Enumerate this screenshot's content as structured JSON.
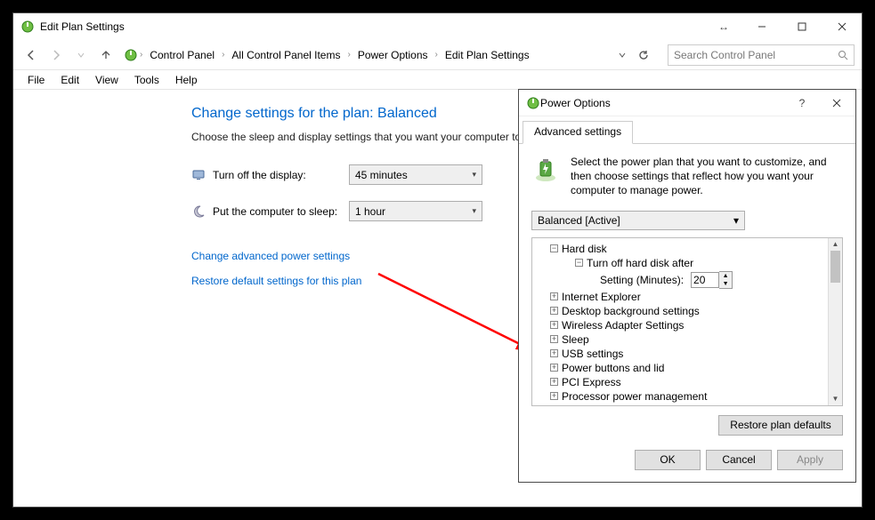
{
  "main": {
    "title": "Edit Plan Settings",
    "breadcrumbs": [
      "Control Panel",
      "All Control Panel Items",
      "Power Options",
      "Edit Plan Settings"
    ],
    "search_placeholder": "Search Control Panel",
    "menu": [
      "File",
      "Edit",
      "View",
      "Tools",
      "Help"
    ],
    "heading": "Change settings for the plan: Balanced",
    "subtext": "Choose the sleep and display settings that you want your computer to use.",
    "rows": {
      "display_label": "Turn off the display:",
      "display_value": "45 minutes",
      "sleep_label": "Put the computer to sleep:",
      "sleep_value": "1 hour"
    },
    "links": {
      "advanced": "Change advanced power settings",
      "restore": "Restore default settings for this plan"
    }
  },
  "dialog": {
    "title": "Power Options",
    "tab": "Advanced settings",
    "desc": "Select the power plan that you want to customize, and then choose settings that reflect how you want your computer to manage power.",
    "plan_combo": "Balanced [Active]",
    "tree": {
      "hard_disk": "Hard disk",
      "turn_off_after": "Turn off hard disk after",
      "setting_label": "Setting (Minutes):",
      "setting_value": "20",
      "items": [
        "Internet Explorer",
        "Desktop background settings",
        "Wireless Adapter Settings",
        "Sleep",
        "USB settings",
        "Power buttons and lid",
        "PCI Express",
        "Processor power management"
      ]
    },
    "restore_btn": "Restore plan defaults",
    "buttons": {
      "ok": "OK",
      "cancel": "Cancel",
      "apply": "Apply"
    }
  }
}
